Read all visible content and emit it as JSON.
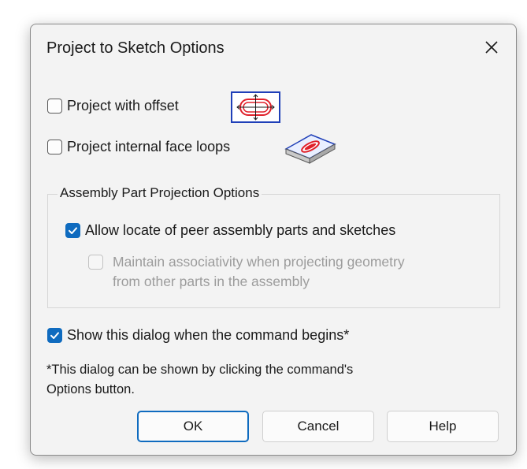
{
  "dialog": {
    "title": "Project to Sketch Options",
    "close_icon": "close-icon"
  },
  "options": {
    "project_with_offset": {
      "label": "Project with offset",
      "checked": false,
      "icon": "offset-sketch-icon"
    },
    "project_internal_loops": {
      "label": "Project internal face loops",
      "checked": false,
      "icon": "internal-face-loop-icon"
    }
  },
  "assembly_group": {
    "title": "Assembly Part Projection Options",
    "allow_locate": {
      "label": "Allow locate of peer assembly parts and sketches",
      "checked": true
    },
    "maintain_assoc": {
      "label_line1": "Maintain associativity when projecting geometry",
      "label_line2": "from other parts in the assembly",
      "checked": false,
      "disabled": true
    }
  },
  "show_dialog": {
    "label": "Show this dialog when the command begins*",
    "checked": true
  },
  "note": {
    "line1": "*This dialog can be shown by clicking the command's",
    "line2": "Options button."
  },
  "buttons": {
    "ok": "OK",
    "cancel": "Cancel",
    "help": "Help"
  },
  "colors": {
    "accent": "#0f6bbf",
    "icon_red": "#e0202a",
    "icon_blue": "#1f3fb8"
  }
}
